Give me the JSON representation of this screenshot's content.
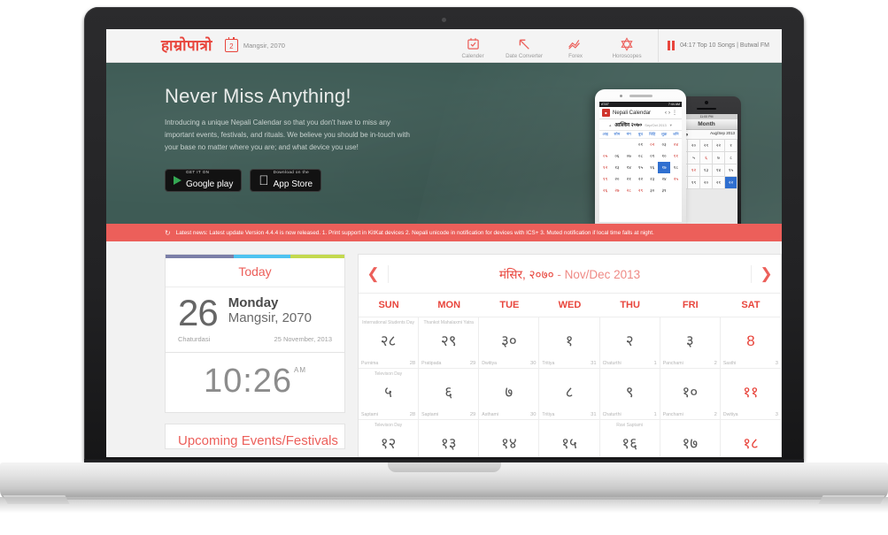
{
  "header": {
    "logo": "हाम्रोपात्रो",
    "date_badge_num": "2",
    "date_text": "Mangsir, 2070",
    "nav": [
      {
        "label": "Calender",
        "icon": "calendar-check-icon"
      },
      {
        "label": "Date Converter",
        "icon": "arrow-up-left-icon"
      },
      {
        "label": "Forex",
        "icon": "line-chart-icon"
      },
      {
        "label": "Horoscopes",
        "icon": "star-of-david-icon"
      }
    ],
    "radio": {
      "icon": "pause-icon",
      "text": "04:17  Top 10 Songs | Butwal FM"
    }
  },
  "hero": {
    "heading": "Never Miss Anything!",
    "paragraph": "Introducing a unique Nepali Calendar so that you don't have to miss any important events, festivals, and rituals. We believe you should be in-touch with your base no matter where you are; and what device you use!",
    "badges": [
      {
        "sub": "GET IT ON",
        "main": "Google play",
        "icon": "google-play-icon"
      },
      {
        "sub": "Download on the",
        "main": "App Store",
        "icon": "apple-icon"
      }
    ],
    "phone_white": {
      "status_carrier": "AT&T",
      "status_time": "7:44 AM",
      "app_name": "Nepali Calendar",
      "month_np": "आश्विन २०७०",
      "month_en": "Sep/Oct 2013",
      "dows": [
        "आइ",
        "सोम",
        "मंग",
        "बुध",
        "बिहि",
        "शुक्र",
        "शनि"
      ],
      "cells": [
        {
          "t": "",
          "c": ""
        },
        {
          "t": "",
          "c": ""
        },
        {
          "t": "",
          "c": ""
        },
        {
          "t": "०१",
          "c": ""
        },
        {
          "t": "०२",
          "c": "red"
        },
        {
          "t": "०३",
          "c": ""
        },
        {
          "t": "०४",
          "c": "red"
        },
        {
          "t": "०५",
          "c": "red"
        },
        {
          "t": "०६",
          "c": ""
        },
        {
          "t": "०७",
          "c": ""
        },
        {
          "t": "०८",
          "c": ""
        },
        {
          "t": "०९",
          "c": ""
        },
        {
          "t": "१०",
          "c": ""
        },
        {
          "t": "११",
          "c": "red"
        },
        {
          "t": "१२",
          "c": "red"
        },
        {
          "t": "१३",
          "c": ""
        },
        {
          "t": "१४",
          "c": ""
        },
        {
          "t": "१५",
          "c": ""
        },
        {
          "t": "१६",
          "c": ""
        },
        {
          "t": "१७",
          "c": "sel"
        },
        {
          "t": "१८",
          "c": ""
        },
        {
          "t": "१९",
          "c": "red"
        },
        {
          "t": "२०",
          "c": ""
        },
        {
          "t": "२१",
          "c": ""
        },
        {
          "t": "२२",
          "c": ""
        },
        {
          "t": "२३",
          "c": ""
        },
        {
          "t": "२४",
          "c": ""
        },
        {
          "t": "२५",
          "c": "red"
        },
        {
          "t": "२६",
          "c": "red"
        },
        {
          "t": "२७",
          "c": "red"
        },
        {
          "t": "२८",
          "c": "red"
        },
        {
          "t": "२९",
          "c": "red"
        },
        {
          "t": "३०",
          "c": ""
        },
        {
          "t": "३१",
          "c": ""
        },
        {
          "t": "",
          "c": ""
        }
      ]
    },
    "phone_black": {
      "status_time": "11:00 PM",
      "title": "Month",
      "month_np": "२०७०",
      "month_en": "Aug/Sep 2013",
      "cells": [
        {
          "t": "१९",
          "c": ""
        },
        {
          "t": "२०",
          "c": ""
        },
        {
          "t": "२१",
          "c": ""
        },
        {
          "t": "२२",
          "c": ""
        },
        {
          "t": "१",
          "c": ""
        },
        {
          "t": "४",
          "c": ""
        },
        {
          "t": "५",
          "c": ""
        },
        {
          "t": "६",
          "c": "red"
        },
        {
          "t": "७",
          "c": ""
        },
        {
          "t": "८",
          "c": ""
        },
        {
          "t": "११",
          "c": ""
        },
        {
          "t": "१२",
          "c": "red"
        },
        {
          "t": "१३",
          "c": ""
        },
        {
          "t": "१४",
          "c": ""
        },
        {
          "t": "१५",
          "c": ""
        },
        {
          "t": "१८",
          "c": ""
        },
        {
          "t": "१९",
          "c": ""
        },
        {
          "t": "२०",
          "c": ""
        },
        {
          "t": "२१",
          "c": ""
        },
        {
          "t": "२२",
          "c": "sel"
        }
      ]
    }
  },
  "news": {
    "icon": "refresh-icon",
    "text": "Latest news: Latest update Version 4.4.4 is now released. 1. Print support in KitKat devices 2. Nepali unicode in notification for devices with ICS+ 3. Muted notification if local time falls at night."
  },
  "today": {
    "heading": "Today",
    "day_number": "26",
    "day_of_week": "Monday",
    "month_year": "Mangsir, 2070",
    "tithi": "Chaturdasi",
    "gregorian": "25 November, 2013",
    "clock_time": "10:26",
    "clock_meridiem": "AM"
  },
  "upcoming": {
    "title": "Upcoming Events/Festivals"
  },
  "calendar": {
    "prev_icon": "chevron-left-icon",
    "next_icon": "chevron-right-icon",
    "title_np": "मंसिर, २०७०",
    "title_en": "- Nov/Dec 2013",
    "dows": [
      "SUN",
      "MON",
      "TUE",
      "WED",
      "THU",
      "FRI",
      "SAT"
    ],
    "days": [
      {
        "event": "International Students Day",
        "np": "२८",
        "tithi": "Purnima",
        "g": "28",
        "red": false
      },
      {
        "event": "Thankot Mahalaxmi Yatra",
        "np": "२९",
        "tithi": "Pratipada",
        "g": "29",
        "red": false
      },
      {
        "event": "",
        "np": "३०",
        "tithi": "Dwitiya",
        "g": "30",
        "red": false
      },
      {
        "event": "",
        "np": "१",
        "tithi": "Tritiya",
        "g": "31",
        "red": false
      },
      {
        "event": "",
        "np": "२",
        "tithi": "Chaturthi",
        "g": "1",
        "red": false
      },
      {
        "event": "",
        "np": "३",
        "tithi": "Panchami",
        "g": "2",
        "red": false
      },
      {
        "event": "",
        "np": "8",
        "tithi": "Sasthi",
        "g": "3",
        "red": true
      },
      {
        "event": "Televison Day",
        "np": "५",
        "tithi": "Saptami",
        "g": "28",
        "red": false
      },
      {
        "event": "",
        "np": "६",
        "tithi": "Saptami",
        "g": "29",
        "red": false
      },
      {
        "event": "",
        "np": "७",
        "tithi": "Asthami",
        "g": "30",
        "red": false
      },
      {
        "event": "",
        "np": "८",
        "tithi": "Tritiya",
        "g": "31",
        "red": false
      },
      {
        "event": "",
        "np": "९",
        "tithi": "Chaturthi",
        "g": "1",
        "red": false
      },
      {
        "event": "",
        "np": "१०",
        "tithi": "Panchami",
        "g": "2",
        "red": false
      },
      {
        "event": "",
        "np": "११",
        "tithi": "Dwitiya",
        "g": "3",
        "red": true
      },
      {
        "event": "Televison Day",
        "np": "१२",
        "tithi": "",
        "g": "",
        "red": false
      },
      {
        "event": "",
        "np": "१३",
        "tithi": "",
        "g": "",
        "red": false
      },
      {
        "event": "",
        "np": "१४",
        "tithi": "",
        "g": "",
        "red": false
      },
      {
        "event": "",
        "np": "१५",
        "tithi": "",
        "g": "",
        "red": false
      },
      {
        "event": "Ravi Saptami",
        "np": "१६",
        "tithi": "",
        "g": "",
        "red": false
      },
      {
        "event": "",
        "np": "१७",
        "tithi": "",
        "g": "",
        "red": false
      },
      {
        "event": "",
        "np": "१८",
        "tithi": "",
        "g": "",
        "red": true
      }
    ]
  }
}
